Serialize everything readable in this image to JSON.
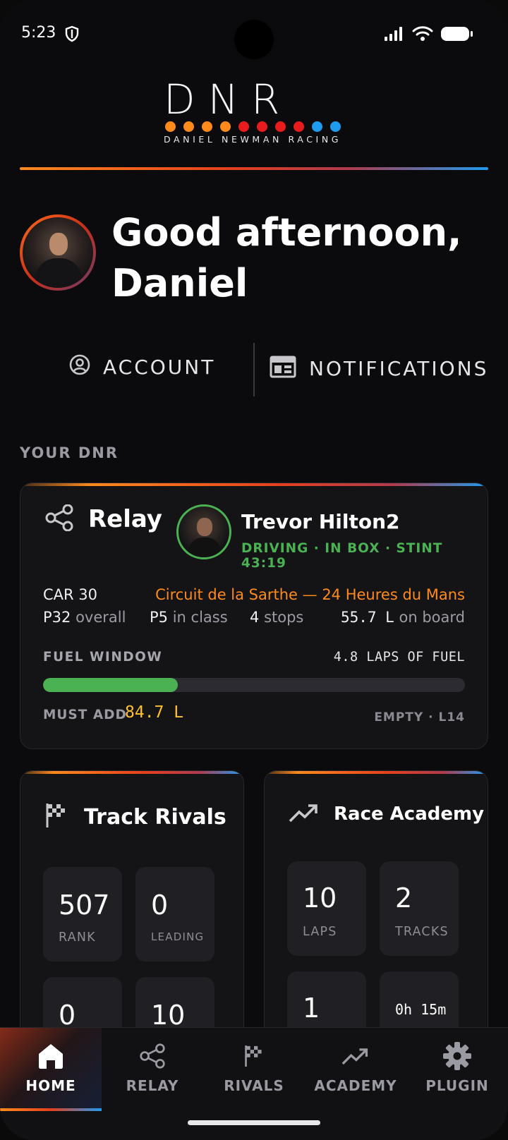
{
  "status_bar": {
    "time": "5:23"
  },
  "brand": {
    "logo_text": "DNR",
    "subtitle": "DANIEL NEWMAN RACING",
    "dot_colors": [
      "#ff8a1c",
      "#ff8a1c",
      "#ff8a1c",
      "#ff8a1c",
      "#e81c1c",
      "#e81c1c",
      "#e81c1c",
      "#e81c1c",
      "#1e9bf0",
      "#1e9bf0"
    ]
  },
  "greeting": {
    "line1": "Good afternoon,",
    "line2": "Daniel"
  },
  "actions": {
    "account_label": "ACCOUNT",
    "notifications_label": "NOTIFICATIONS"
  },
  "section_label": "YOUR DNR",
  "relay": {
    "title": "Relay",
    "driver_name": "Trevor Hilton2",
    "driver_status": "DRIVING · IN BOX · STINT 43:19",
    "car": "CAR 30",
    "track": "Circuit de la Sarthe — 24 Heures du Mans",
    "overall_pos": "P32",
    "overall_label": "overall",
    "class_pos": "P5",
    "class_label": "in class",
    "stops_value": "4",
    "stops_label": "stops",
    "fuel_on_board_value": "55.7 L",
    "fuel_on_board_label": "on board",
    "fuel_window_label": "FUEL WINDOW",
    "fuel_laps_label": "4.8 LAPS OF FUEL",
    "fuel_fill_fraction": 0.32,
    "must_add_label": "MUST ADD",
    "must_add_value": "84.7 L",
    "empty_label": "EMPTY · L14",
    "accent_color": "#4bb253"
  },
  "track_rivals": {
    "title": "Track Rivals",
    "tiles": [
      {
        "value": "507",
        "label": "RANK"
      },
      {
        "value": "0",
        "label": "LEADING"
      },
      {
        "value": "0",
        "label": ""
      },
      {
        "value": "10",
        "label": ""
      }
    ]
  },
  "race_academy": {
    "title": "Race Academy",
    "tiles": [
      {
        "value": "10",
        "label": "LAPS"
      },
      {
        "value": "2",
        "label": "TRACKS"
      },
      {
        "value": "1",
        "label": ""
      },
      {
        "value": "0h 15m",
        "label": ""
      }
    ]
  },
  "bottom_nav": [
    {
      "label": "HOME",
      "icon": "home-icon",
      "active": true
    },
    {
      "label": "RELAY",
      "icon": "share-icon",
      "active": false
    },
    {
      "label": "RIVALS",
      "icon": "checkered-flag-icon",
      "active": false
    },
    {
      "label": "ACADEMY",
      "icon": "trending-up-icon",
      "active": false
    },
    {
      "label": "PLUGIN",
      "icon": "gear-icon",
      "active": false
    }
  ]
}
